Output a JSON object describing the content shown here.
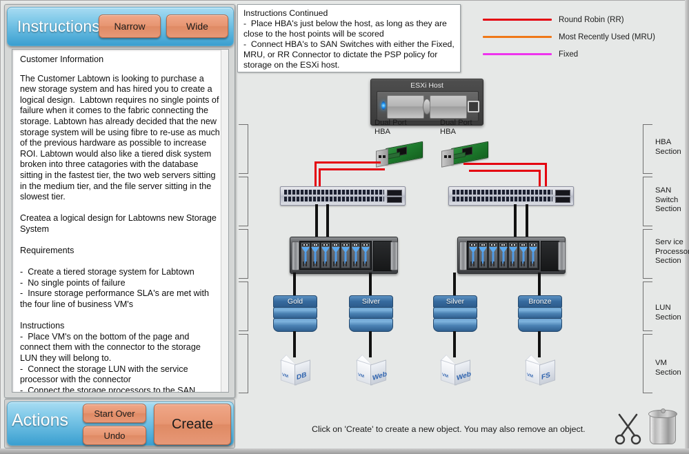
{
  "app": {
    "background_color": "#e6e8e7",
    "hint": "Click on 'Create' to create a new object.  You may also remove an object."
  },
  "instructions_panel": {
    "title": "Instructions",
    "narrow_label": "Narrow",
    "wide_label": "Wide",
    "body_heading": "Customer Information",
    "body": "The Customer Labtown is looking to purchase a new storage system and has hired you to create a logical design.  Labtown requires no single points of failure when it comes to the fabric connecting the storage. Labtown has already decided that the new storage system will be using fibre to re-use as much of the previous hardware as possible to increase ROI. Labtown would also like a tiered disk system broken into three catagories with the database sitting in the fastest tier, the two web servers sitting in the medium tier, and the file server sitting in the slowest tier.\n\nCreatea a logical design for Labtowns new Storage System\n\nRequirements\n\n-  Create a tiered storage system for Labtown\n-  No single points of failure\n-  Insure storage performance SLA's are met with the four line of business VM's\n\nInstructions\n-  Place VM's on the bottom of the page and connect them with the connector to the storage LUN they will belong to.\n-  Connect the storage LUN with the service processor with the connector\n-  Connect the storage processors to the SAN switch"
  },
  "instructions_continued": {
    "text": "Instructions Continued\n-  Place HBA's just below the host, as long as they are close to the host points will be scored\n-  Connect HBA's to SAN Switches with either the Fixed, MRU, or RR Connector to dictate the PSP policy for storage on the ESXi host."
  },
  "legend": {
    "items": [
      {
        "label": "Round Robin (RR)",
        "color": "#e4000f"
      },
      {
        "label": "Most Recently Used (MRU)",
        "color": "#f07818"
      },
      {
        "label": "Fixed",
        "color": "#ee33ee"
      }
    ]
  },
  "actions_panel": {
    "title": "Actions",
    "start_over_label": "Start Over",
    "undo_label": "Undo",
    "create_label": "Create"
  },
  "sections": [
    {
      "name": "hba",
      "label": "HBA\nSection"
    },
    {
      "name": "san-switch",
      "label": "SAN\nSwitch\nSection"
    },
    {
      "name": "service-processor",
      "label": "Serv ice\nProcessor\nSection"
    },
    {
      "name": "lun",
      "label": "LUN\nSection"
    },
    {
      "name": "vm",
      "label": "VM\nSection"
    }
  ],
  "diagram": {
    "host": {
      "label": "ESXi Host"
    },
    "hbas": [
      {
        "label": "Dual Port\nHBA"
      },
      {
        "label": "Dual Port\nHBA"
      }
    ],
    "switches": [
      {
        "name": "san-switch-1"
      },
      {
        "name": "san-switch-2"
      }
    ],
    "service_processors": [
      {
        "name": "service-processor-1"
      },
      {
        "name": "service-processor-2"
      }
    ],
    "luns": [
      {
        "tier": "Gold"
      },
      {
        "tier": "Silver"
      },
      {
        "tier": "Silver"
      },
      {
        "tier": "Bronze"
      }
    ],
    "vms": [
      {
        "tag": "VM",
        "name": "DB"
      },
      {
        "tag": "VM",
        "name": "Web"
      },
      {
        "tag": "VM",
        "name": "Web"
      },
      {
        "tag": "VM",
        "name": "FS"
      }
    ]
  },
  "tools": {
    "scissors": "scissors-icon",
    "trash": "trash-icon"
  }
}
